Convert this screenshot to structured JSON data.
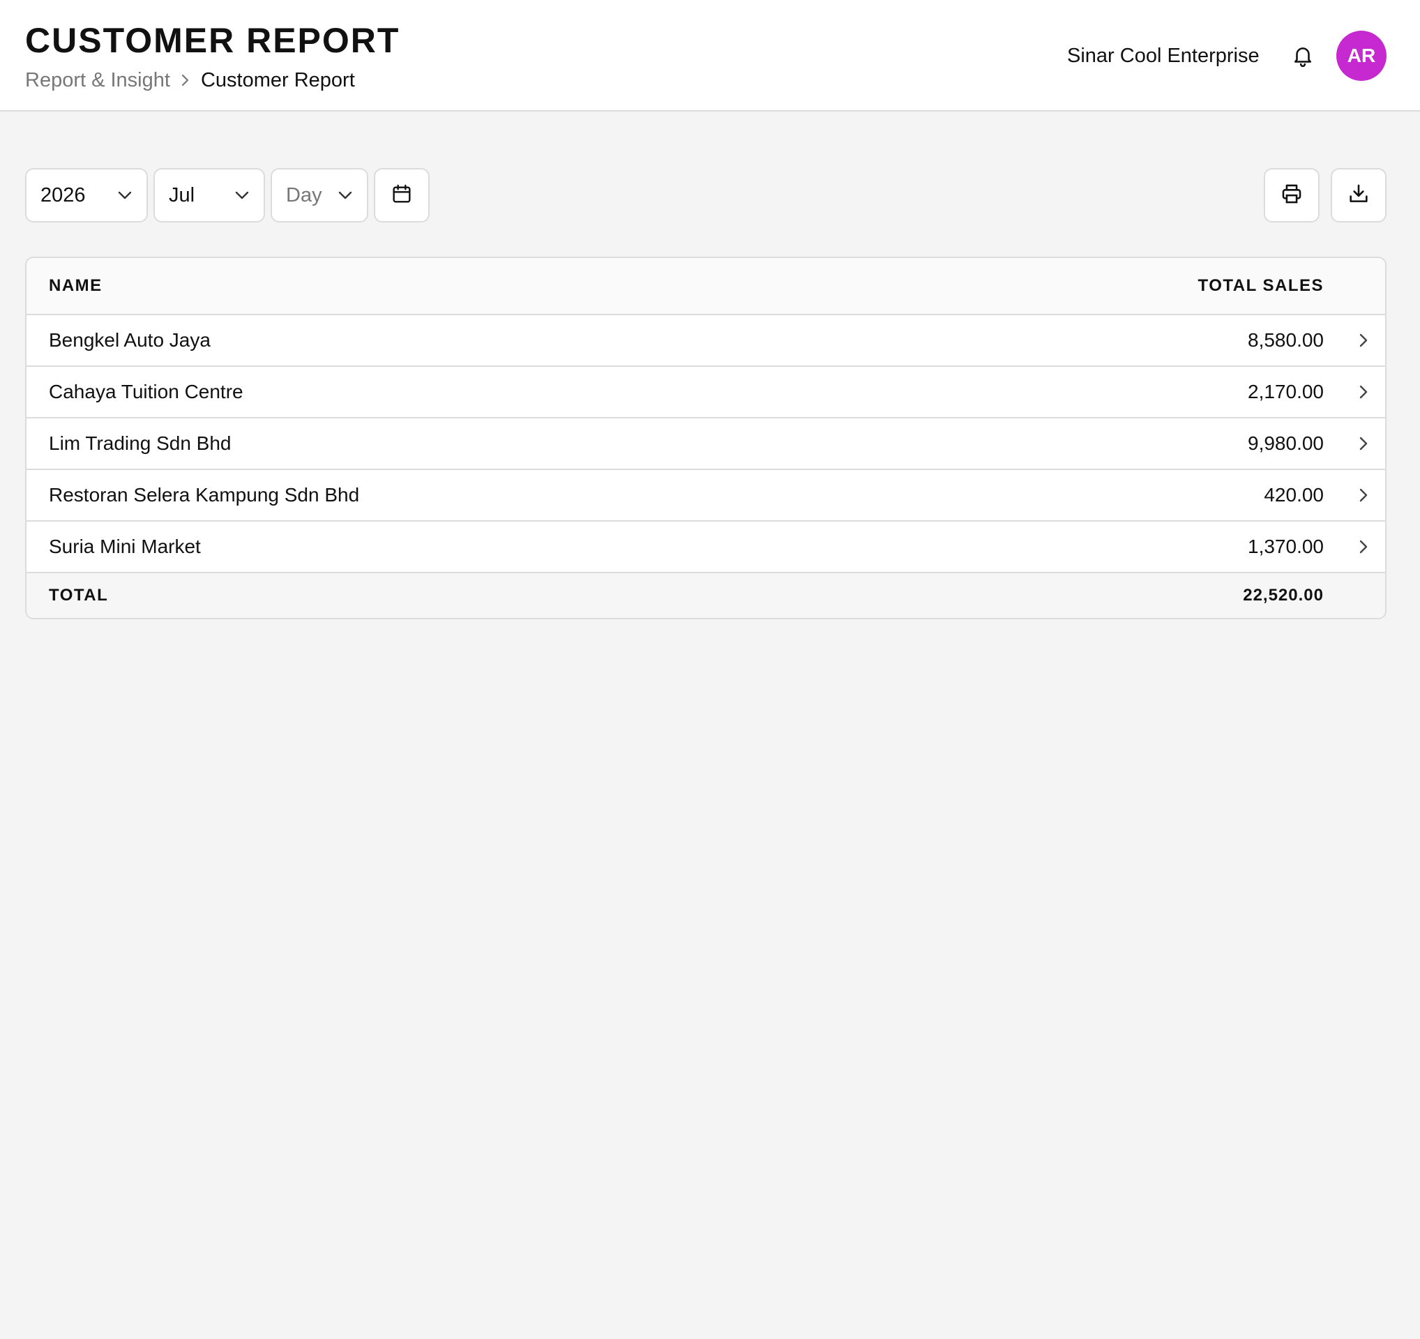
{
  "header": {
    "title": "CUSTOMER REPORT",
    "breadcrumb": {
      "parent": "Report & Insight",
      "current": "Customer Report"
    },
    "company": "Sinar Cool Enterprise",
    "avatar_initials": "AR",
    "avatar_color": "#c629cf",
    "icons": {
      "notifications": "bell-icon",
      "breadcrumb_separator": "chevron-right-icon"
    }
  },
  "filters": {
    "year": "2026",
    "month": "Jul",
    "day_placeholder": "Day",
    "icons": {
      "calendar": "calendar-icon",
      "dropdown": "chevron-down-icon"
    }
  },
  "actions": {
    "print_icon": "printer-icon",
    "download_icon": "download-icon"
  },
  "table": {
    "columns": {
      "name": "NAME",
      "total_sales": "TOTAL SALES"
    },
    "rows": [
      {
        "name": "Bengkel Auto Jaya",
        "total_sales": "8,580.00"
      },
      {
        "name": "Cahaya Tuition Centre",
        "total_sales": "2,170.00"
      },
      {
        "name": "Lim Trading Sdn Bhd",
        "total_sales": "9,980.00"
      },
      {
        "name": "Restoran Selera Kampung Sdn Bhd",
        "total_sales": "420.00"
      },
      {
        "name": "Suria Mini Market",
        "total_sales": "1,370.00"
      }
    ],
    "footer": {
      "label": "TOTAL",
      "value": "22,520.00"
    }
  }
}
